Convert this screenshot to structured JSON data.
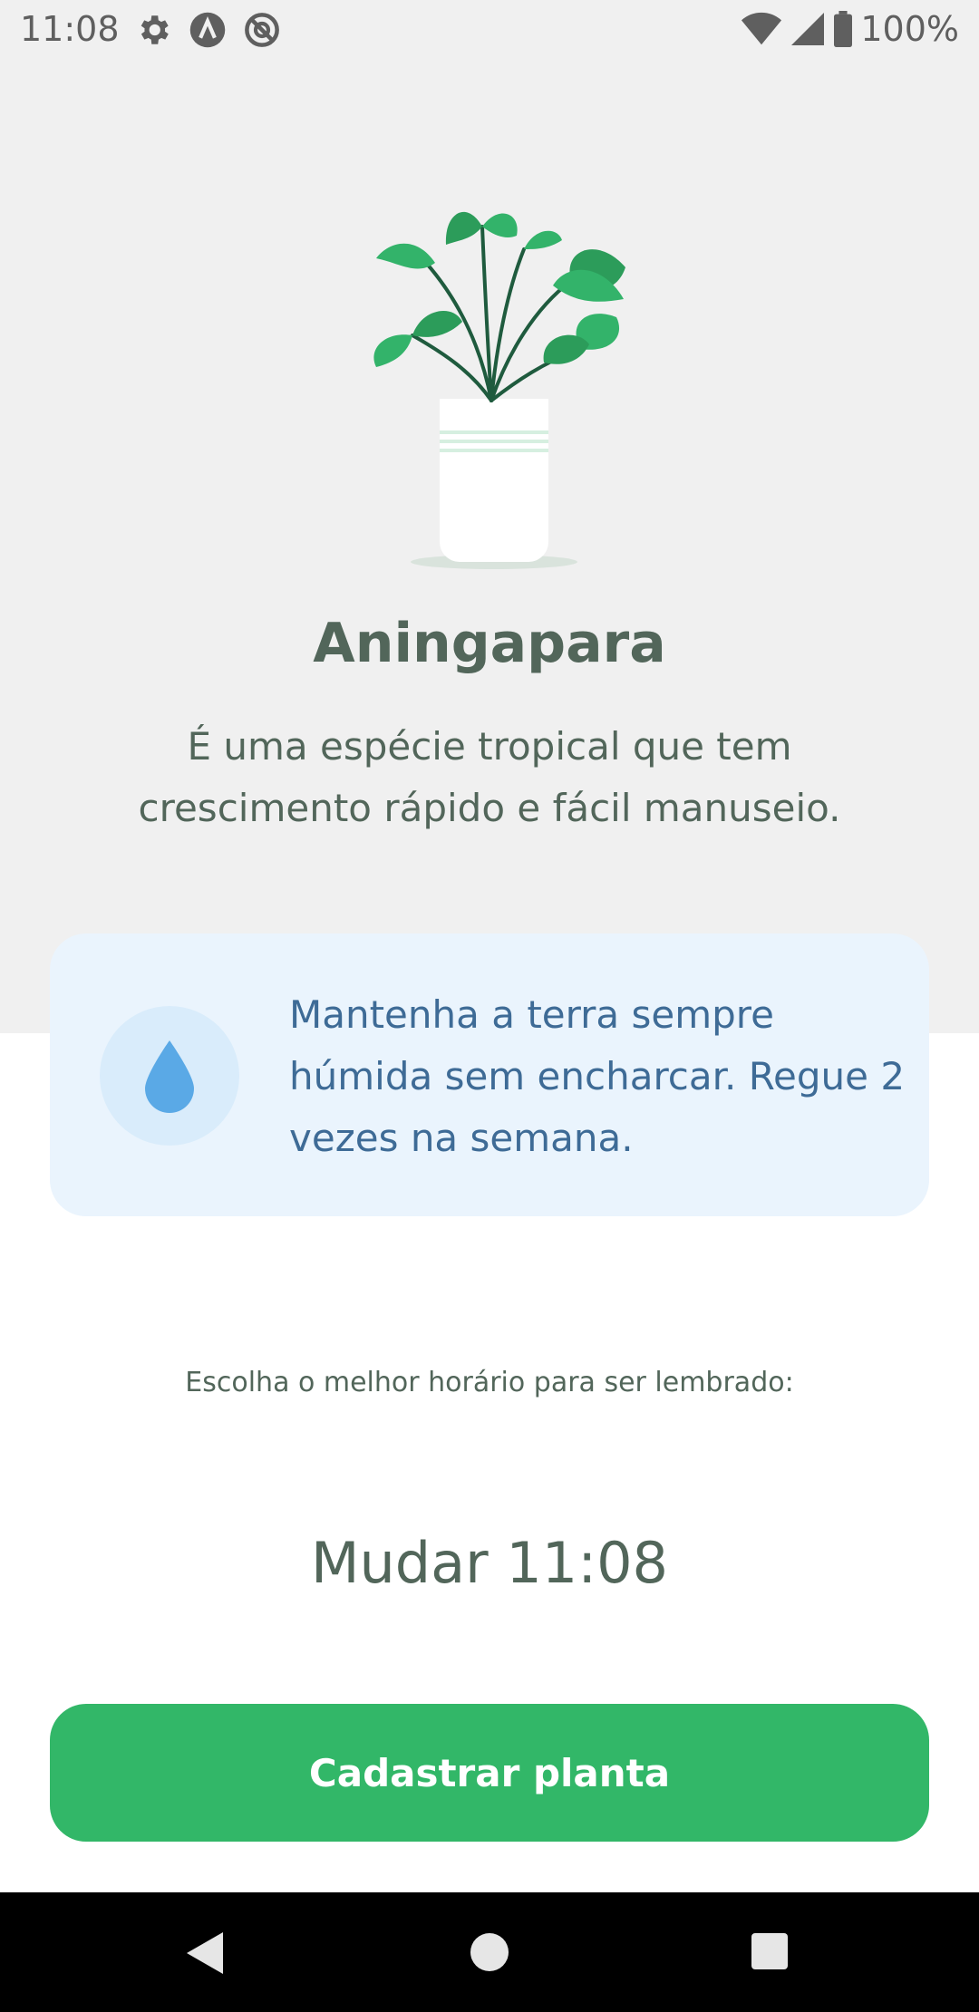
{
  "status_bar": {
    "time": "11:08",
    "battery": "100%",
    "icons": [
      "gear-icon",
      "a-icon",
      "no-sign-icon",
      "wifi-icon",
      "signal-icon",
      "battery-icon"
    ]
  },
  "plant": {
    "name": "Aningapara",
    "about": "É uma espécie tropical que tem crescimento rápido e fácil manuseio."
  },
  "tip": {
    "icon": "water-drop-icon",
    "text": "Mantenha a terra sempre húmida sem encharcar. Regue 2 vezes na semana."
  },
  "reminder": {
    "label": "Escolha o melhor horário para ser lembrado:",
    "button": "Mudar 11:08"
  },
  "actions": {
    "primary": "Cadastrar planta"
  },
  "colors": {
    "brand_green": "#32b768",
    "heading": "#52665a",
    "tip_background": "#eaf4fd",
    "tip_text": "#3e6b96",
    "drop": "#5aa9e6"
  }
}
